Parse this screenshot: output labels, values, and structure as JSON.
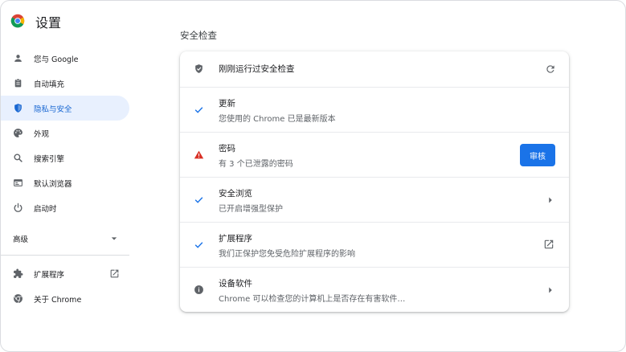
{
  "app": {
    "title": "设置"
  },
  "sidebar": {
    "items": [
      {
        "label": "您与 Google",
        "icon": "person-icon"
      },
      {
        "label": "自动填充",
        "icon": "clipboard-icon"
      },
      {
        "label": "隐私与安全",
        "icon": "shield-icon",
        "active": true
      },
      {
        "label": "外观",
        "icon": "palette-icon"
      },
      {
        "label": "搜索引擎",
        "icon": "search-icon"
      },
      {
        "label": "默认浏览器",
        "icon": "browser-icon"
      },
      {
        "label": "启动时",
        "icon": "power-icon"
      }
    ],
    "advanced_label": "高级",
    "bottom_items": [
      {
        "label": "扩展程序",
        "icon": "puzzle-icon"
      },
      {
        "label": "关于 Chrome",
        "icon": "chrome-icon"
      }
    ]
  },
  "main": {
    "section_title": "安全检查",
    "header_row": {
      "label": "刚刚运行过安全检查"
    },
    "rows": [
      {
        "title": "更新",
        "subtitle": "您使用的 Chrome 已是最新版本",
        "status": "ok"
      },
      {
        "title": "密码",
        "subtitle": "有 3 个已泄露的密码",
        "status": "warning",
        "button": "审核"
      },
      {
        "title": "安全浏览",
        "subtitle": "已开启增强型保护",
        "status": "ok"
      },
      {
        "title": "扩展程序",
        "subtitle": "我们正保护您免受危险扩展程序的影响",
        "status": "ok"
      },
      {
        "title": "设备软件",
        "subtitle": "Chrome 可以检查您的计算机上是否存在有害软件…",
        "status": "info"
      }
    ]
  },
  "colors": {
    "accent": "#1a73e8",
    "active_bg": "#e8f0fe",
    "active_text": "#1967d2",
    "warning": "#d93025",
    "icon_gray": "#5f6368"
  }
}
